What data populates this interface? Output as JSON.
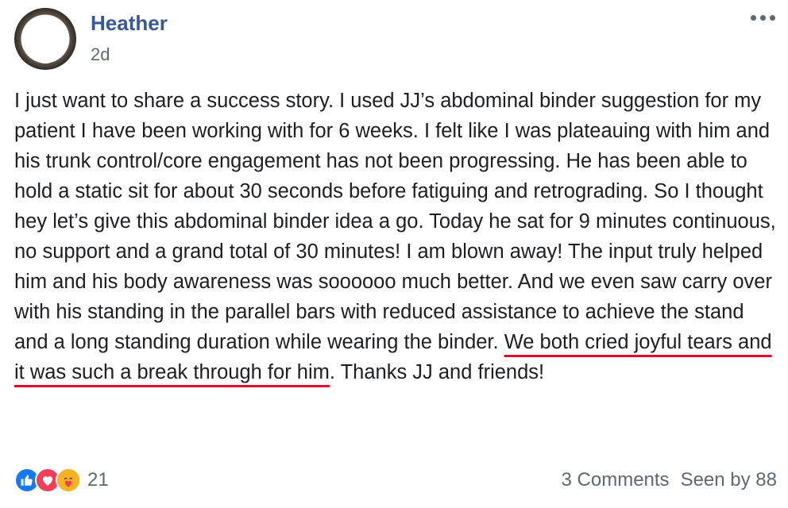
{
  "author": {
    "name": "Heather",
    "time": "2d"
  },
  "post": {
    "text_before": "I just want to share a success story. I used JJ’s abdominal binder suggestion for my patient I have been working with for 6 weeks. I felt like I was plateauing with him and his trunk control/core engagement has not been progressing. He has been able to hold a static sit for about 30 seconds before fatiguing and retrograding. So I thought hey let’s give this abdominal binder idea a go. Today he sat for 9 minutes continuous, no support and a grand total of 30 minutes! I am blown away! The input truly helped him and his body awareness was soooooo much better. And we even saw carry over with his standing in the parallel bars with reduced assistance to achieve the stand and a long standing duration while wearing the binder. ",
    "highlighted": "We both cried joyful tears and it was such a break through for him",
    "text_after": ". Thanks JJ and friends!"
  },
  "reactions": {
    "icons": [
      "like-icon",
      "love-icon",
      "care-icon"
    ],
    "count": "21"
  },
  "stats": {
    "comments": "3 Comments",
    "seen": "Seen by 88"
  },
  "colors": {
    "author": "#385898",
    "underline": "#e4002b",
    "like": "#1877f2",
    "love": "#f33e58",
    "care": "#f7b125"
  }
}
